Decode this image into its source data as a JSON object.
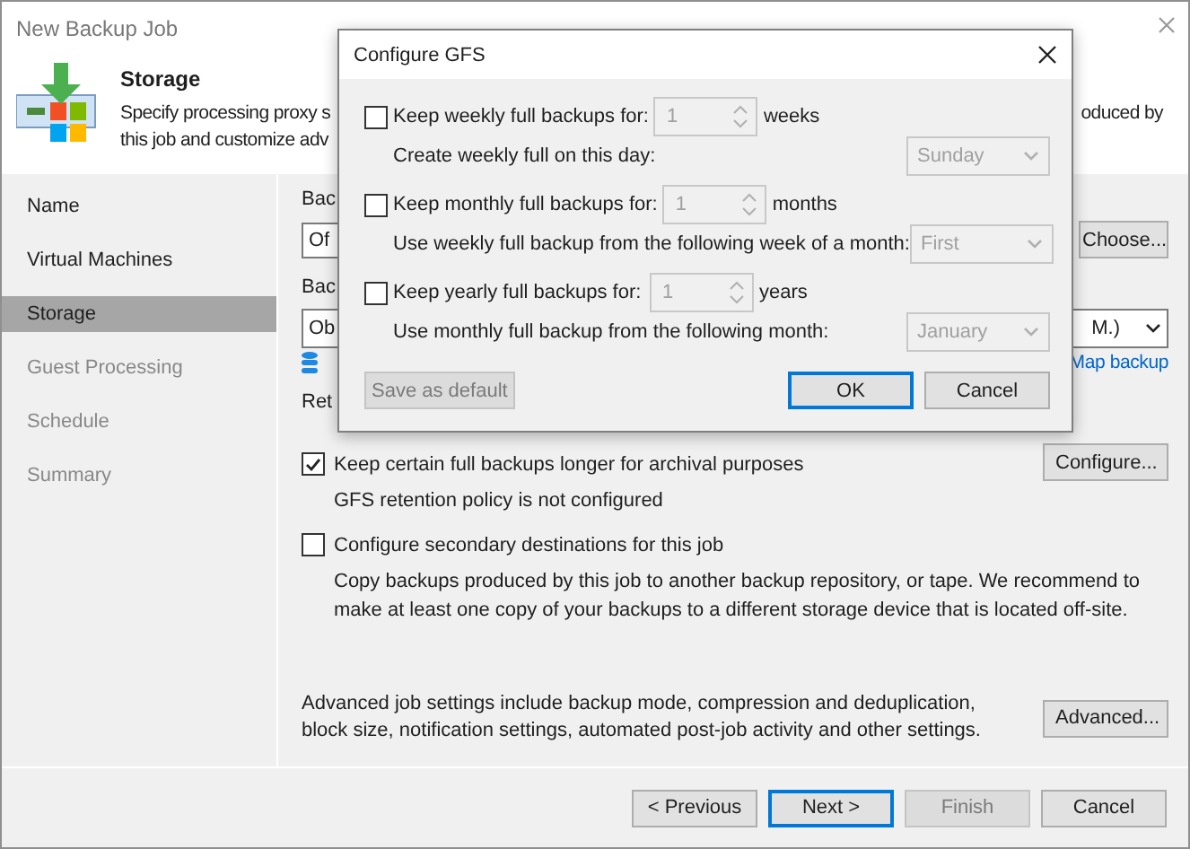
{
  "window": {
    "title": "New Backup Job"
  },
  "header": {
    "title": "Storage",
    "line_1_start": "Specify processing proxy s",
    "line_1_end": "oduced by",
    "line_2_start": "this job and customize adv"
  },
  "nav": [
    {
      "label": "Name",
      "selected": false,
      "disabled": false
    },
    {
      "label": "Virtual Machines",
      "selected": false,
      "disabled": false
    },
    {
      "label": "Storage",
      "selected": true,
      "disabled": false
    },
    {
      "label": "Guest Processing",
      "selected": false,
      "disabled": true
    },
    {
      "label": "Schedule",
      "selected": false,
      "disabled": true
    },
    {
      "label": "Summary",
      "selected": false,
      "disabled": true
    }
  ],
  "content": {
    "proxy_label": "Bac",
    "proxy_value": "Of",
    "choose_button": "Choose...",
    "repository_label": "Bac",
    "repository_value_start": "Ob",
    "repository_value_end": "M.)",
    "map_backup_link": "Map backup",
    "retention_label": "Ret",
    "options": [
      {
        "label": "Keep certain full backups longer for archival purposes",
        "checked": true,
        "note": "GFS retention policy is not configured",
        "button": "Configure..."
      },
      {
        "label": "Configure secondary destinations for this job",
        "checked": false,
        "note": "Copy backups produced by this job to another backup repository, or tape. We recommend to make at least one copy of your backups to a different storage device that is located off-site."
      }
    ],
    "advanced_text": "Advanced job settings include backup mode, compression and deduplication, block size, notification settings, automated post-job activity and other settings.",
    "advanced_button": "Advanced..."
  },
  "footer_buttons": [
    {
      "label": "< Previous",
      "disabled": false,
      "default": false
    },
    {
      "label": "Next >",
      "disabled": false,
      "default": true
    },
    {
      "label": "Finish",
      "disabled": true,
      "default": false
    },
    {
      "label": "Cancel",
      "disabled": false,
      "default": false
    }
  ],
  "dialog": {
    "title": "Configure GFS",
    "rows": [
      {
        "label": "Keep weekly full backups for:",
        "checked": false,
        "value": "1",
        "unit": "weeks",
        "sub_label": "Create weekly full on this day:",
        "sub_value": "Sunday"
      },
      {
        "label": "Keep monthly full backups for:",
        "checked": false,
        "value": "1",
        "unit": "months",
        "sub_label": "Use weekly full backup from the following week of a month:",
        "sub_value": "First"
      },
      {
        "label": "Keep yearly full backups for:",
        "checked": false,
        "value": "1",
        "unit": "years",
        "sub_label": "Use monthly full backup from the following month:",
        "sub_value": "January"
      }
    ],
    "save_default": {
      "label": "Save as default",
      "disabled": true
    },
    "buttons": [
      {
        "label": "OK",
        "default": true
      },
      {
        "label": "Cancel",
        "default": false
      }
    ]
  }
}
